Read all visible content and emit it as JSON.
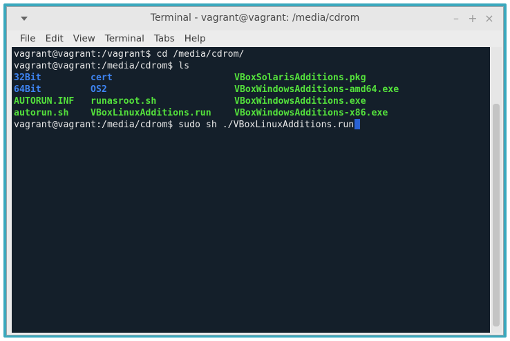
{
  "window": {
    "title": "Terminal - vagrant@vagrant: /media/cdrom",
    "controls": {
      "minimize": "–",
      "maximize": "+",
      "close": "×"
    }
  },
  "menu": {
    "items": [
      "File",
      "Edit",
      "View",
      "Terminal",
      "Tabs",
      "Help"
    ]
  },
  "terminal": {
    "line1": "vagrant@vagrant:/vagrant$ cd /media/cdrom/",
    "line2": "vagrant@vagrant:/media/cdrom$ ls",
    "listing": [
      [
        "32Bit",
        "cert",
        "VBoxSolarisAdditions.pkg"
      ],
      [
        "64Bit",
        "OS2",
        "VBoxWindowsAdditions-amd64.exe"
      ],
      [
        "AUTORUN.INF",
        "runasroot.sh",
        "VBoxWindowsAdditions.exe"
      ],
      [
        "autorun.sh",
        "VBoxLinuxAdditions.run",
        "VBoxWindowsAdditions-x86.exe"
      ]
    ],
    "line7": "vagrant@vagrant:/media/cdrom$ sudo sh ./VBoxLinuxAdditions.run",
    "colors": {
      "background": "#141f2a",
      "directory": "#3e84f2",
      "executable": "#54e13c",
      "text": "#e6e6e6"
    }
  }
}
